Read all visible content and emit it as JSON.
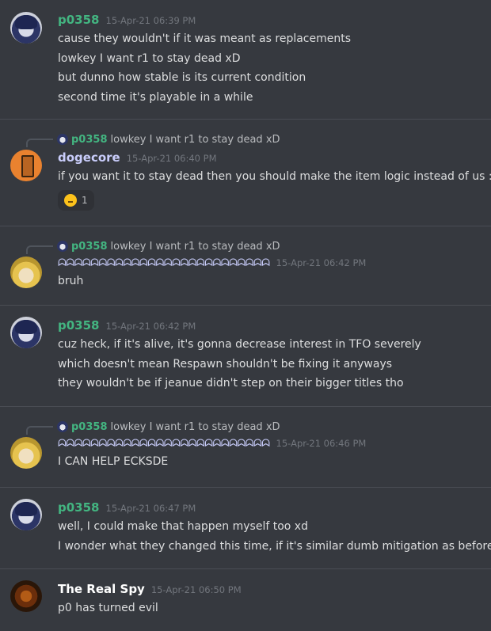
{
  "colors": {
    "background": "#36393f",
    "p0358": "#43b581",
    "dogecore": "#c9cdfb",
    "anime_user": "#c9cdfb",
    "the_real_spy": "#ffffff",
    "timestamp": "#72767d"
  },
  "messages": [
    {
      "author": "p0358",
      "timestamp": "15-Apr-21 06:39 PM",
      "lines": [
        "cause they wouldn't if it was meant as replacements",
        "lowkey I want r1 to stay dead xD",
        "but dunno how stable is its current condition",
        "second time it's playable in a while"
      ]
    },
    {
      "reply": {
        "author": "p0358",
        "text": "lowkey I want r1 to stay dead xD"
      },
      "author": "dogecore",
      "timestamp": "15-Apr-21 06:40 PM",
      "lines": [
        "if you want it to stay dead then you should make the item logic instead of us :P"
      ],
      "reaction": {
        "emoji": "thinking-face",
        "count": "1"
      }
    },
    {
      "reply": {
        "author": "p0358",
        "text": "lowkey I want r1 to stay dead xD"
      },
      "author": "ᗣᗣᗣᗣᗣᗣᗣᗣᗣᗣᗣᗣᗣᗣᗣᗣᗣᗣᗣᗣᗣᗣᗣᗣᗣᗣ",
      "timestamp": "15-Apr-21 06:42 PM",
      "lines": [
        "bruh"
      ]
    },
    {
      "author": "p0358",
      "timestamp": "15-Apr-21 06:42 PM",
      "lines": [
        "cuz heck, if it's alive, it's gonna decrease interest in TFO severely",
        "which doesn't mean Respawn shouldn't be fixing it anyways",
        "they wouldn't be if jeanue didn't step on their bigger titles tho"
      ]
    },
    {
      "reply": {
        "author": "p0358",
        "text": "lowkey I want r1 to stay dead xD"
      },
      "author": "ᗣᗣᗣᗣᗣᗣᗣᗣᗣᗣᗣᗣᗣᗣᗣᗣᗣᗣᗣᗣᗣᗣᗣᗣᗣᗣ",
      "timestamp": "15-Apr-21 06:46 PM",
      "lines": [
        "I CAN HELP ECKSDE"
      ]
    },
    {
      "author": "p0358",
      "timestamp": "15-Apr-21 06:47 PM",
      "lines": [
        "well, I could make that happen myself too xd",
        "I wonder what they changed this time, if it's similar dumb mitigation as before"
      ]
    },
    {
      "author": "The Real Spy",
      "timestamp": "15-Apr-21 06:50 PM",
      "lines": [
        "p0 has turned evil"
      ]
    }
  ]
}
